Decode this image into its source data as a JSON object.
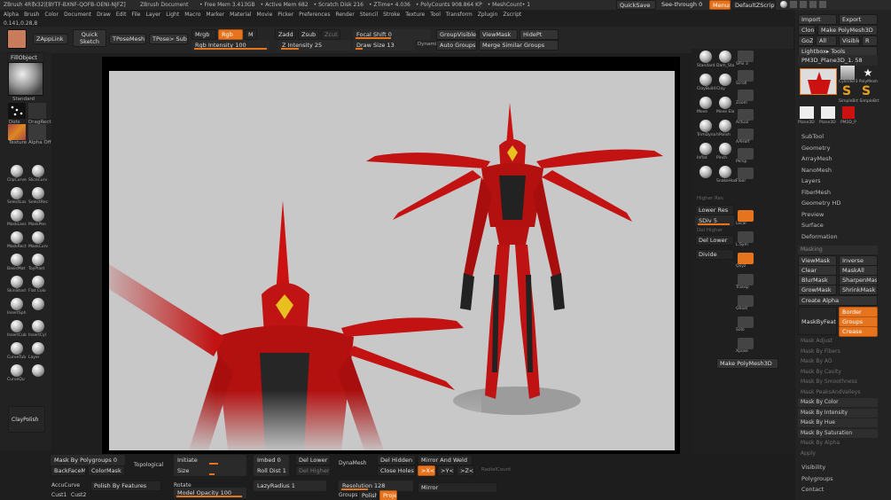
{
  "title_bar": {
    "app": "ZBrush 4R7",
    "build": "(x32)[BYTF-BXNF-QOFB-OENI-NJFZ]",
    "document": "ZBrush Document",
    "stats": [
      "• Free Mem 3.413GB",
      "• Active Mem 682",
      "• Scratch Disk 216",
      "• ZTime• 4.036",
      "• PolyCounts 908.864 KP",
      "• MeshCount• 1"
    ],
    "quicksave": "QuickSave",
    "seethrough": "See-through 0",
    "menus": "Menus",
    "script": "DefaultZScript"
  },
  "menu_bar": [
    "Alpha",
    "Brush",
    "Color",
    "Document",
    "Draw",
    "Edit",
    "File",
    "Layer",
    "Light",
    "Macro",
    "Marker",
    "Material",
    "Movie",
    "Picker",
    "Preferences",
    "Render",
    "Stencil",
    "Stroke",
    "Texture",
    "Tool",
    "Transform",
    "Zplugin",
    "Zscript"
  ],
  "coords": "0.141,0.28,8",
  "top_shelf": {
    "zapplink": "ZAppLink",
    "quick_sketch": "Quick Sketch",
    "tpose_mesh": "TPoseMesh",
    "tpose_subt": "TPose> SubT",
    "mrgb": "Mrgb",
    "rgb": "Rgb",
    "m": "M",
    "rgb_intensity": "Rgb Intensity 100",
    "zadd": "Zadd",
    "zsub": "Zsub",
    "zcut": "Zcut",
    "z_intensity": "Z Intensity 25",
    "focal_shift": "Focal Shift 0",
    "draw_size": "Draw Size 13",
    "dynamic": "Dynamic",
    "group_visible": "GroupVisible",
    "view_mask": "ViewMask",
    "hide_pt": "HidePt",
    "auto_groups": "Auto Groups",
    "merge_similar": "Merge Similar Groups"
  },
  "left_shelf": {
    "fill_object": "FillObject",
    "standard": "Standard",
    "dots": "Dots",
    "drag_rect": "DragRect",
    "texture": "Texture",
    "alpha": "Alpha Off",
    "brushes": [
      [
        "ClipCurve",
        "SliceCurv"
      ],
      [
        "SelectLas",
        "SelectRec"
      ],
      [
        "MaskLass",
        "MaskPen"
      ],
      [
        "MaskRect",
        "MaskCurv"
      ],
      [
        "BasicMat",
        "ToyPlast"
      ],
      [
        "SkinShad",
        "Flat Colo"
      ],
      [
        "InsertSph",
        ""
      ],
      [
        "InsertCub",
        "InsertCyl"
      ],
      [
        "CurveTub",
        "Layer"
      ],
      [
        "CurveQu",
        ""
      ]
    ],
    "clay_polish": "ClayPolish"
  },
  "right_shelf": {
    "brushes": [
      [
        "Standard",
        "Dam_Sta"
      ],
      [
        "ClayBuild",
        "Clay"
      ],
      [
        "Move",
        "Move Ela"
      ],
      [
        "TrimDyna",
        "hPolish"
      ],
      [
        "Inflat",
        "Pinch"
      ],
      [
        "",
        "SnakeHoo"
      ]
    ],
    "icons": [
      "SPix 3",
      "Scroll",
      "Zoom",
      "Actual",
      "AAHalf",
      "Persp",
      "Floor",
      "Local",
      "L.Sym",
      "Qxyz",
      "Transp",
      "Ghost",
      "Solo",
      "Xpose"
    ],
    "higher_res": "Higher Res",
    "lower_res": "Lower Res",
    "sdiv": "SDiv 5",
    "del_higher": "Del Higher",
    "del_lower": "Del Lower",
    "divide": "Divide",
    "make_polymesh": "Make PolyMesh3D"
  },
  "right_panel": {
    "import": "Import",
    "export": "Export",
    "clone": "Clone",
    "make_polymesh": "Make PolyMesh3D",
    "goz": "GoZ",
    "all": "All",
    "visible": "Visible",
    "r": "R",
    "lightbox_tools": "Lightbox▸ Tools",
    "current_tool": "PM3D_Plane3D_1. 58",
    "thumbs": [
      "Cylinder3 PolyMesh",
      "SimpleBrt SimpleBrt",
      "Plane3D",
      "Plane3D",
      "PM3D_P"
    ],
    "sections": [
      "SubTool",
      "Geometry",
      "ArrayMesh",
      "NanoMesh",
      "Layers",
      "FiberMesh",
      "Geometry HD",
      "Preview",
      "Surface",
      "Deformation"
    ],
    "masking_header": "Masking",
    "view_mask": "ViewMask",
    "inverse": "Inverse",
    "clear": "Clear",
    "mask_all": "MaskAll",
    "blur_mask": "BlurMask",
    "sharpen_mask": "SharpenMask",
    "grow_mask": "GrowMask",
    "shrink_mask": "ShrinkMask",
    "create_alpha": "Create Alpha",
    "mask_by_feature": "MaskByFeatur",
    "border": "Border",
    "groups": "Groups",
    "crease": "Crease",
    "mask_options": [
      [
        "Mask Adjust",
        true
      ],
      [
        "Mask By Fibers",
        true
      ],
      [
        "Mask By AO",
        true
      ],
      [
        "Mask By Cavity",
        true
      ],
      [
        "Mask By Smoothness",
        true
      ],
      [
        "Mask PeaksAndValleys",
        true
      ],
      [
        "Mask By Color",
        false
      ],
      [
        "Mask By Intensity",
        false
      ],
      [
        "Mask By Hue",
        false
      ],
      [
        "Mask By Saturation",
        false
      ],
      [
        "Mask By Alpha",
        true
      ],
      [
        "Apply",
        true
      ]
    ],
    "bottom_sections": [
      "Visibility",
      "Polygroups",
      "Contact"
    ]
  },
  "bottom_shelf": {
    "mask_by_polygroups": "Mask By Polygroups 0",
    "backface_mask": "BackFaceMask",
    "color_mask": "ColorMask",
    "topological": "Topological",
    "initiate": "Initiate",
    "size": "Size",
    "imbed": "Imbed 0",
    "roll_dist": "Roll Dist 1",
    "del_lower": "Del Lower",
    "del_higher": "Del Higher",
    "dynamesh": "DynaMesh",
    "del_hidden": "Del Hidden",
    "close_holes": "Close Holes",
    "mirror_and_weld": "Mirror And Weld",
    "x": ">X<",
    "y": ">Y<",
    "z": ">Z<",
    "radial_count": "RadialCount",
    "accu_curve": "AccuCurve",
    "polish_by_features": "Polish By Features",
    "rotate": "Rotate",
    "model_opacity": "Model Opacity 100",
    "lazy_radius": "LazyRadius 1",
    "cust1": "Cust1",
    "cust2": "Cust2",
    "resolution": "Resolution 128",
    "groups": "Groups",
    "polish": "Polish",
    "project": "Project",
    "mirror": "Mirror"
  },
  "colors": {
    "accent": "#e6741e",
    "model_red": "#d11818",
    "canvas": "#c8c8c8",
    "primary_swatch": "#c87c5c"
  }
}
